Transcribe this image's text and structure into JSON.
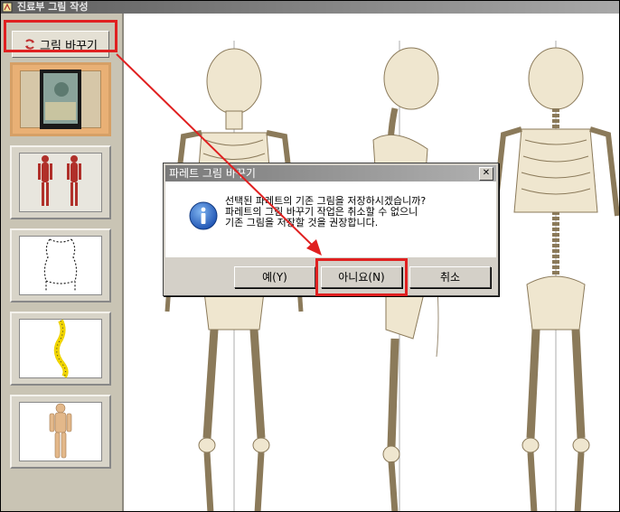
{
  "window": {
    "title": "진료부 그림 작성"
  },
  "sidebar": {
    "change_button_label": "그림 바꾸기",
    "thumbnails": [
      {
        "name": "book-cover"
      },
      {
        "name": "muscle-figures"
      },
      {
        "name": "torso-outline"
      },
      {
        "name": "spine-yellow"
      },
      {
        "name": "body-figure"
      }
    ]
  },
  "dialog": {
    "title": "파레트 그림 바꾸기",
    "message_lines": [
      "선택된 파레트의 기존 그림을 저장하시겠습니까?",
      "파레트의 그림 바꾸기 작업은 취소할 수 없으니",
      "기존 그림을 저장할 것을 권장합니다."
    ],
    "buttons": {
      "yes": "예(Y)",
      "no": "아니요(N)",
      "cancel": "취소"
    }
  },
  "colors": {
    "highlight": "#e02020",
    "selected_thumb": "#e9b075"
  }
}
